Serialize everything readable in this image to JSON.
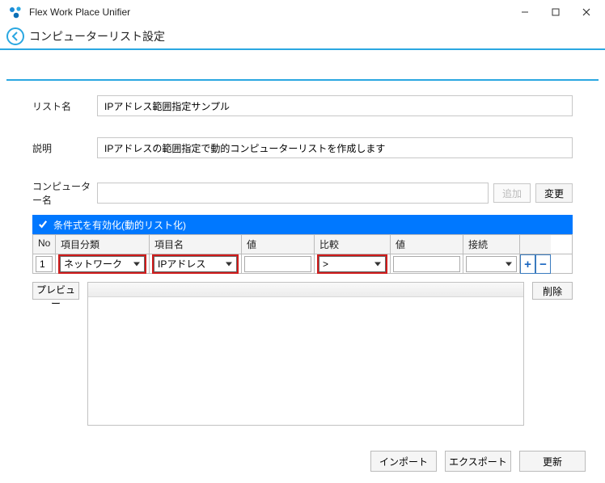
{
  "appTitle": "Flex Work Place Unifier",
  "pageTitle": "コンピューターリスト設定",
  "labels": {
    "listName": "リスト名",
    "desc": "説明",
    "computerName": "コンピューター名",
    "add": "追加",
    "change": "変更",
    "enableCond": "条件式を有効化(動的リスト化)",
    "preview": "プレビュー",
    "delete": "削除",
    "import": "インポート",
    "export": "エクスポート",
    "update": "更新"
  },
  "values": {
    "listName": "IPアドレス範囲指定サンプル",
    "desc": "IPアドレスの範囲指定で動的コンピューターリストを作成します",
    "computerName": "",
    "enableCond": true
  },
  "condHeaders": {
    "no": "No",
    "category": "項目分類",
    "item": "項目名",
    "valLabel": "値",
    "compare": "比較",
    "val2Label": "値",
    "conn": "接続"
  },
  "condRow": {
    "no": "1",
    "category": "ネットワーク",
    "item": "IPアドレス",
    "val": "",
    "compare": ">",
    "val2": "",
    "conn": ""
  }
}
